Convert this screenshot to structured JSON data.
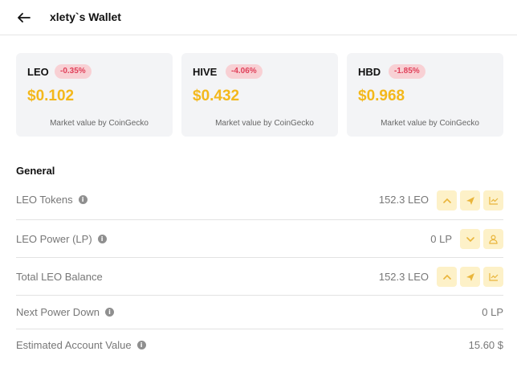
{
  "header": {
    "title": "xlety`s Wallet",
    "back_icon": "arrow-left-icon"
  },
  "tokens": [
    {
      "symbol": "LEO",
      "change": "-0.35%",
      "price": "$0.102",
      "source": "Market value by CoinGecko"
    },
    {
      "symbol": "HIVE",
      "change": "-4.06%",
      "price": "$0.432",
      "source": "Market value by CoinGecko"
    },
    {
      "symbol": "HBD",
      "change": "-1.85%",
      "price": "$0.968",
      "source": "Market value by CoinGecko"
    }
  ],
  "general": {
    "title": "General",
    "rows": [
      {
        "label": "LEO Tokens",
        "value": "152.3 LEO",
        "actions": [
          "chevron-up-icon",
          "send-icon",
          "chart-icon"
        ]
      },
      {
        "label": "LEO Power (LP)",
        "value": "0 LP",
        "actions": [
          "chevron-down-icon",
          "user-icon"
        ]
      },
      {
        "label": "Total LEO Balance",
        "value": "152.3 LEO",
        "actions": [
          "chevron-up-icon",
          "send-icon",
          "chart-icon"
        ]
      },
      {
        "label": "Next Power Down",
        "value": "0 LP",
        "actions": []
      },
      {
        "label": "Estimated Account Value",
        "value": "15.60 $",
        "actions": []
      }
    ]
  },
  "colors": {
    "accent": "#f3b81c",
    "negative_change_bg": "#f8d0d4",
    "negative_change_text": "#e0405a",
    "card_bg": "#f3f4f6",
    "action_bg": "#fdf1c8"
  }
}
